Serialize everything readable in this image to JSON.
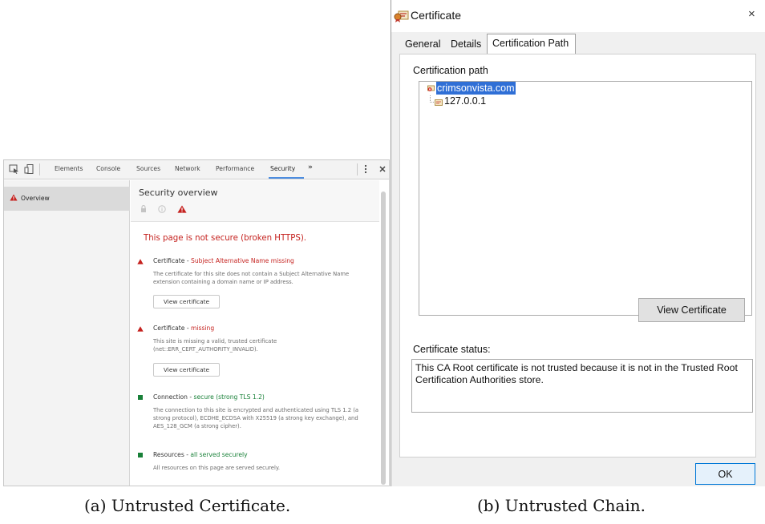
{
  "devtools": {
    "tabs": [
      "Elements",
      "Console",
      "Sources",
      "Network",
      "Performance",
      "Security"
    ],
    "active_tab": "Security",
    "more_tabs": "»",
    "sidebar_overview": "Overview",
    "title": "Security overview",
    "summary": "This page is not secure (broken HTTPS).",
    "explanations": [
      {
        "title": "Certificate - ",
        "status": "Subject Alternative Name missing",
        "status_color": "#c5221f",
        "description": "The certificate for this site does not contain a Subject Alternative Name extension containing a domain name or IP address.",
        "button": "View certificate"
      },
      {
        "title": "Certificate - ",
        "status": "missing",
        "status_color": "#c5221f",
        "description": "This site is missing a valid, trusted certificate (net::ERR_CERT_AUTHORITY_INVALID).",
        "button": "View certificate"
      },
      {
        "title": "Connection - ",
        "status": "secure (strong TLS 1.2)",
        "status_color": "#188038",
        "description": "The connection to this site is encrypted and authenticated using TLS 1.2 (a strong protocol), ECDHE_ECDSA with X25519 (a strong key exchange), and AES_128_GCM (a strong cipher)."
      },
      {
        "title": "Resources - ",
        "status": "all served securely",
        "status_color": "#188038",
        "description": "All resources on this page are served securely."
      }
    ]
  },
  "certificate": {
    "window_title": "Certificate",
    "close": "×",
    "tabs": [
      "General",
      "Details",
      "Certification Path"
    ],
    "active_tab": "Certification Path",
    "path_label": "Certification path",
    "path": [
      "crimsonvista.com",
      "127.0.0.1"
    ],
    "view_button": "View Certificate",
    "status_label": "Certificate status:",
    "status_text": "This CA Root certificate is not trusted because it is not in the Trusted Root Certification Authorities store.",
    "ok_button": "OK"
  },
  "captions": [
    "(a) Untrusted Certificate.",
    "(b) Untrusted Chain."
  ]
}
